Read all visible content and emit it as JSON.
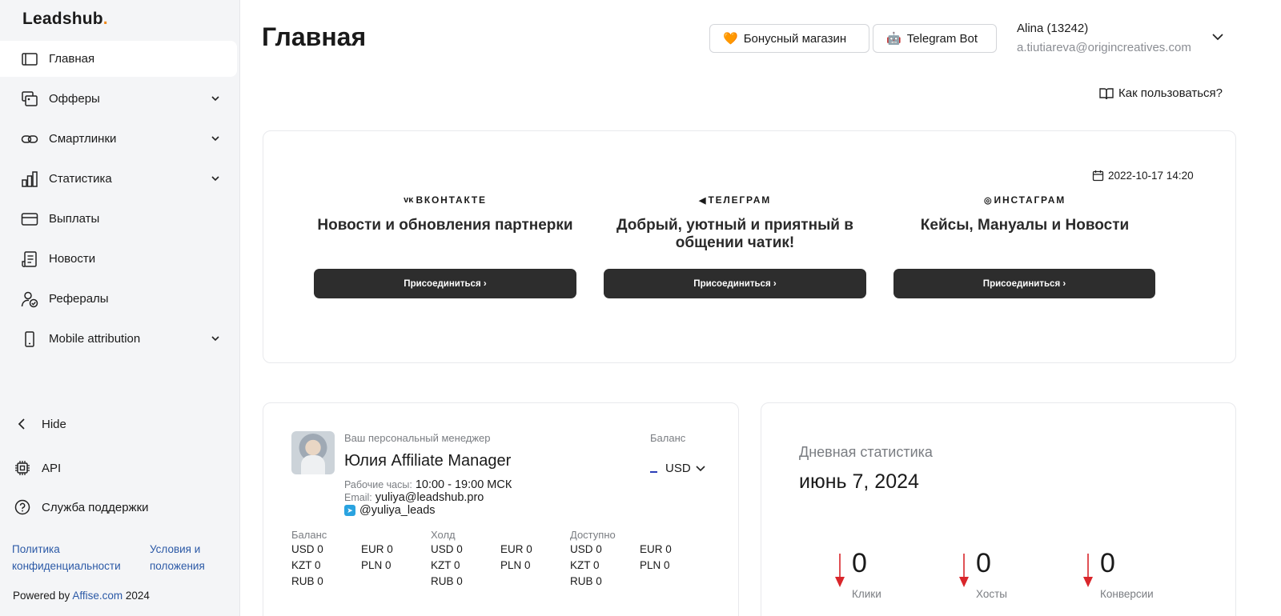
{
  "brand": {
    "logo_text": "Leadshub",
    "logo_dot": ".",
    "accent_color": "#f08a1c"
  },
  "sidebar": {
    "items": [
      {
        "label": "Главная",
        "icon": "home-icon",
        "active": true,
        "has_chevron": false
      },
      {
        "label": "Офферы",
        "icon": "offers-icon",
        "has_chevron": true
      },
      {
        "label": "Смартлинки",
        "icon": "link-icon",
        "has_chevron": true
      },
      {
        "label": "Статистика",
        "icon": "bar-chart-icon",
        "has_chevron": true
      },
      {
        "label": "Выплаты",
        "icon": "credit-card-icon",
        "has_chevron": false
      },
      {
        "label": "Новости",
        "icon": "news-icon",
        "has_chevron": false
      },
      {
        "label": "Рефералы",
        "icon": "referral-icon",
        "has_chevron": false
      },
      {
        "label": "Mobile attribution",
        "icon": "mobile-icon",
        "has_chevron": true
      }
    ],
    "hide_label": "Hide",
    "api_label": "API",
    "support_label": "Служба поддержки",
    "privacy_link": "Политика конфиденциальности",
    "terms_link": "Условия и положения",
    "powered_prefix": "Powered by",
    "powered_link": "Affise.com",
    "powered_year": "2024"
  },
  "header": {
    "title": "Главная",
    "bonus_button": "Бонусный магазин",
    "bonus_emoji": "🧡",
    "telegram_button": "Telegram Bot",
    "telegram_emoji": "🤖",
    "user_name": "Alina (13242)",
    "user_email": "a.tiutiareva@origincreatives.com",
    "help_link": "Как пользоваться?"
  },
  "social": {
    "timestamp": "2022-10-17 14:20",
    "columns": [
      {
        "brand_icon": "vk-icon",
        "brand_glyph": "ᴠᴋ",
        "brand": "ВКОНТАКТЕ",
        "headline": "Новости и обновления партнерки",
        "button": "Присоединиться ›"
      },
      {
        "brand_icon": "telegram-icon",
        "brand_glyph": "◀",
        "brand": "ТЕЛЕГРАМ",
        "headline": "Добрый, уютный и приятный в общении чатик!",
        "button": "Присоединиться ›"
      },
      {
        "brand_icon": "instagram-icon",
        "brand_glyph": "◎",
        "brand": "ИНСТАГРАМ",
        "headline": "Кейсы, Мануалы и Новости",
        "button": "Присоединиться ›"
      }
    ]
  },
  "manager": {
    "caption": "Ваш персональный менеджер",
    "name": "Юлия Affiliate Manager",
    "hours_label": "Рабочие часы:",
    "hours": "10:00 - 19:00 МСК",
    "email_label": "Email:",
    "email": "yuliya@leadshub.pro",
    "telegram": "@yuliya_leads",
    "balance_caption": "Баланс",
    "currency": "USD"
  },
  "balances": [
    {
      "title": "Баланс",
      "rows": [
        [
          "USD 0",
          "EUR 0"
        ],
        [
          "KZT 0",
          "PLN 0"
        ],
        [
          "RUB 0",
          ""
        ]
      ]
    },
    {
      "title": "Холд",
      "rows": [
        [
          "USD 0",
          "EUR 0"
        ],
        [
          "KZT 0",
          "PLN 0"
        ],
        [
          "RUB 0",
          ""
        ]
      ]
    },
    {
      "title": "Доступно",
      "rows": [
        [
          "USD 0",
          "EUR 0"
        ],
        [
          "KZT 0",
          "PLN 0"
        ],
        [
          "RUB 0",
          ""
        ]
      ]
    }
  ],
  "daily_stats": {
    "title": "Дневная статистика",
    "date": "июнь 7, 2024",
    "trend_color": "#d9262b",
    "items": [
      {
        "value": "0",
        "label": "Клики"
      },
      {
        "value": "0",
        "label": "Хосты"
      },
      {
        "value": "0",
        "label": "Конверсии"
      }
    ]
  }
}
